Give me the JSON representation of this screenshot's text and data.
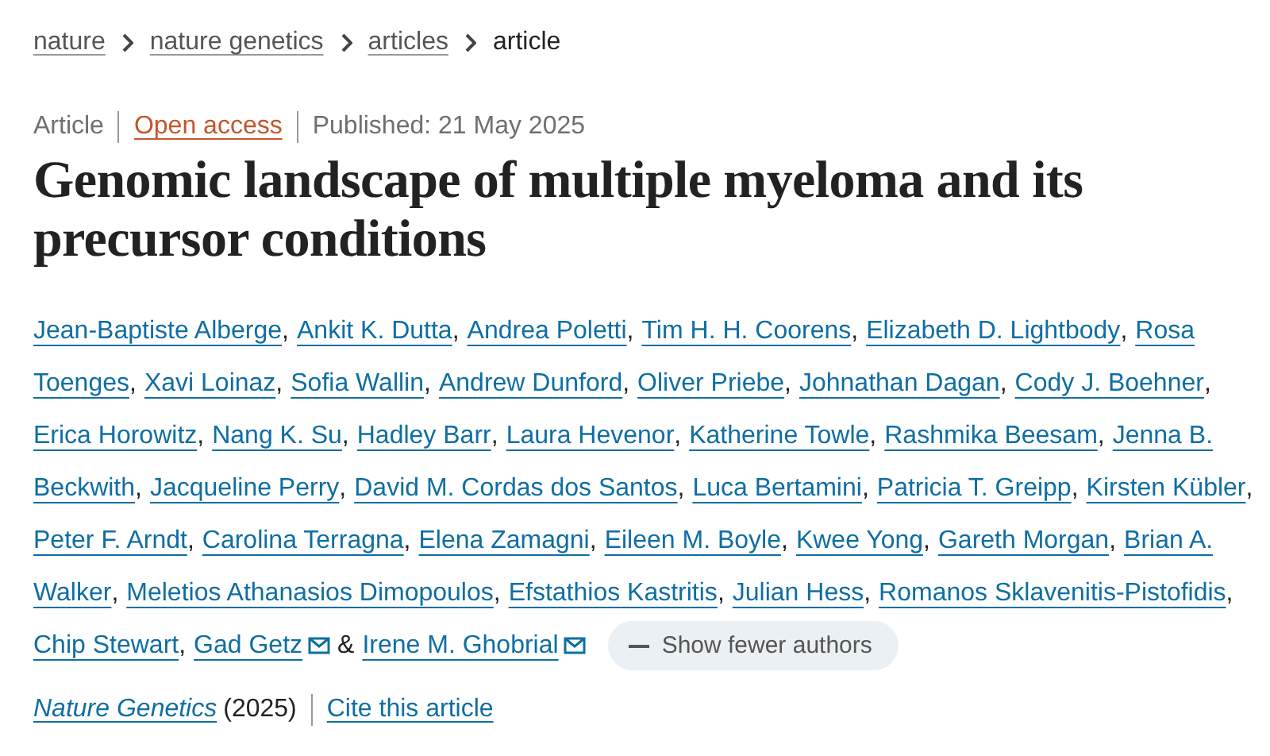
{
  "breadcrumbs": [
    {
      "label": "nature",
      "current": false
    },
    {
      "label": "nature genetics",
      "current": false
    },
    {
      "label": "articles",
      "current": false
    },
    {
      "label": "article",
      "current": true
    }
  ],
  "meta": {
    "type": "Article",
    "access": "Open access",
    "published": "Published: 21 May 2025"
  },
  "title": "Genomic landscape of multiple myeloma and its precursor conditions",
  "author_lines": [
    [
      {
        "name": "Jean-Baptiste Alberge",
        "corresponding": false,
        "separator": ","
      },
      {
        "name": "Ankit K. Dutta",
        "corresponding": false,
        "separator": ","
      },
      {
        "name": "Andrea Poletti",
        "corresponding": false,
        "separator": ","
      },
      {
        "name": "Tim H. H. Coorens",
        "corresponding": false,
        "separator": ","
      },
      {
        "name": "Elizabeth D. Lightbody",
        "corresponding": false,
        "separator": ","
      },
      {
        "name": "Rosa",
        "corresponding": false
      }
    ],
    [
      {
        "name": "Toenges",
        "corresponding": false,
        "separator": ","
      },
      {
        "name": "Xavi Loinaz",
        "corresponding": false,
        "separator": ","
      },
      {
        "name": "Sofia Wallin",
        "corresponding": false,
        "separator": ","
      },
      {
        "name": "Andrew Dunford",
        "corresponding": false,
        "separator": ","
      },
      {
        "name": "Oliver Priebe",
        "corresponding": false,
        "separator": ","
      },
      {
        "name": "Johnathan Dagan",
        "corresponding": false,
        "separator": ","
      },
      {
        "name": "Cody J. Boehner",
        "corresponding": false,
        "separator": ","
      }
    ],
    [
      {
        "name": "Erica Horowitz",
        "corresponding": false,
        "separator": ","
      },
      {
        "name": "Nang K. Su",
        "corresponding": false,
        "separator": ","
      },
      {
        "name": "Hadley Barr",
        "corresponding": false,
        "separator": ","
      },
      {
        "name": "Laura Hevenor",
        "corresponding": false,
        "separator": ","
      },
      {
        "name": "Katherine Towle",
        "corresponding": false,
        "separator": ","
      },
      {
        "name": "Rashmika Beesam",
        "corresponding": false,
        "separator": ","
      },
      {
        "name": "Jenna B.",
        "corresponding": false
      }
    ],
    [
      {
        "name": "Beckwith",
        "corresponding": false,
        "separator": ","
      },
      {
        "name": "Jacqueline Perry",
        "corresponding": false,
        "separator": ","
      },
      {
        "name": "David M. Cordas dos Santos",
        "corresponding": false,
        "separator": ","
      },
      {
        "name": "Luca Bertamini",
        "corresponding": false,
        "separator": ","
      },
      {
        "name": "Patricia T. Greipp",
        "corresponding": false,
        "separator": ","
      },
      {
        "name": "Kirsten Kübler",
        "corresponding": false,
        "separator": ","
      }
    ],
    [
      {
        "name": "Peter F. Arndt",
        "corresponding": false,
        "separator": ","
      },
      {
        "name": "Carolina Terragna",
        "corresponding": false,
        "separator": ","
      },
      {
        "name": "Elena Zamagni",
        "corresponding": false,
        "separator": ","
      },
      {
        "name": "Eileen M. Boyle",
        "corresponding": false,
        "separator": ","
      },
      {
        "name": "Kwee Yong",
        "corresponding": false,
        "separator": ","
      },
      {
        "name": "Gareth Morgan",
        "corresponding": false,
        "separator": ","
      },
      {
        "name": "Brian A.",
        "corresponding": false
      }
    ],
    [
      {
        "name": "Walker",
        "corresponding": false,
        "separator": ","
      },
      {
        "name": "Meletios Athanasios Dimopoulos",
        "corresponding": false,
        "separator": ","
      },
      {
        "name": "Efstathios Kastritis",
        "corresponding": false,
        "separator": ","
      },
      {
        "name": "Julian Hess",
        "corresponding": false,
        "separator": ","
      },
      {
        "name": "Romanos Sklavenitis-Pistofidis",
        "corresponding": false,
        "separator": ","
      }
    ],
    [
      {
        "name": "Chip Stewart",
        "corresponding": false,
        "separator": ","
      },
      {
        "name": "Gad Getz",
        "corresponding": true,
        "separator": "&"
      },
      {
        "name": "Irene M. Ghobrial",
        "corresponding": true
      }
    ]
  ],
  "toggle_authors": "Show fewer authors",
  "citation": {
    "journal": "Nature Genetics",
    "year": "(2025)",
    "cite": "Cite this article"
  }
}
